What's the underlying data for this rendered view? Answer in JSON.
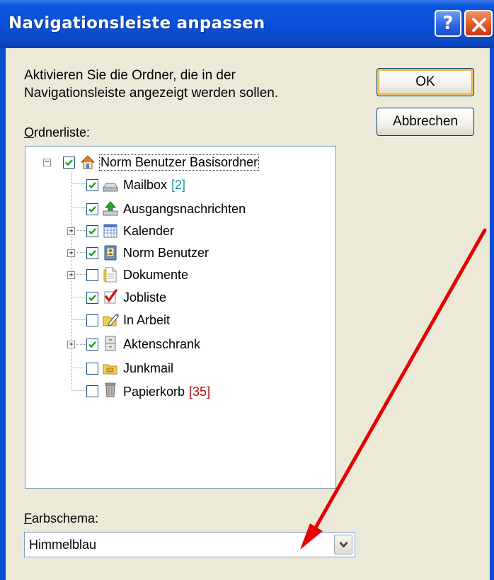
{
  "window": {
    "title": "Navigationsleiste anpassen",
    "help_label": "?",
    "close_icon": "close-x-icon"
  },
  "instruction": {
    "line1": "Aktivieren Sie die Ordner, die in der",
    "line2": "Navigationsleiste angezeigt werden sollen."
  },
  "buttons": {
    "ok": "OK",
    "cancel": "Abbrechen"
  },
  "folder_list": {
    "label_first": "O",
    "label_rest": "rdnerliste:",
    "items": [
      {
        "label": "Norm Benutzer Basisordner",
        "checked": true,
        "icon": "home-icon",
        "expander": "collapse",
        "count": ""
      },
      {
        "label": "Mailbox",
        "checked": true,
        "icon": "inbox-tray-icon",
        "expander": "",
        "count": "[2]"
      },
      {
        "label": "Ausgangsnachrichten",
        "checked": true,
        "icon": "outbox-icon",
        "expander": "",
        "count": ""
      },
      {
        "label": "Kalender",
        "checked": true,
        "icon": "calendar-icon",
        "expander": "expand",
        "count": ""
      },
      {
        "label": "Norm Benutzer",
        "checked": true,
        "icon": "contacts-book-icon",
        "expander": "expand",
        "count": ""
      },
      {
        "label": "Dokumente",
        "checked": false,
        "icon": "document-icon",
        "expander": "expand",
        "count": ""
      },
      {
        "label": "Jobliste",
        "checked": true,
        "icon": "red-checkmark-icon",
        "expander": "",
        "count": ""
      },
      {
        "label": "In Arbeit",
        "checked": false,
        "icon": "folder-pencil-icon",
        "expander": "",
        "count": ""
      },
      {
        "label": "Aktenschrank",
        "checked": true,
        "icon": "file-cabinet-icon",
        "expander": "expand",
        "count": ""
      },
      {
        "label": "Junkmail",
        "checked": false,
        "icon": "junk-folder-icon",
        "expander": "",
        "count": ""
      },
      {
        "label": "Papierkorb",
        "checked": false,
        "icon": "trash-can-icon",
        "expander": "",
        "count": "[35]"
      }
    ]
  },
  "color_scheme": {
    "label_first": "F",
    "label_rest": "arbschema:",
    "selected": "Himmelblau"
  },
  "colors": {
    "title_bar": "#0a4fd8",
    "dialog_bg": "#ece9d8",
    "annotation_arrow": "#e60000",
    "count_blue": "#1a9bb3",
    "count_red": "#b01010"
  }
}
